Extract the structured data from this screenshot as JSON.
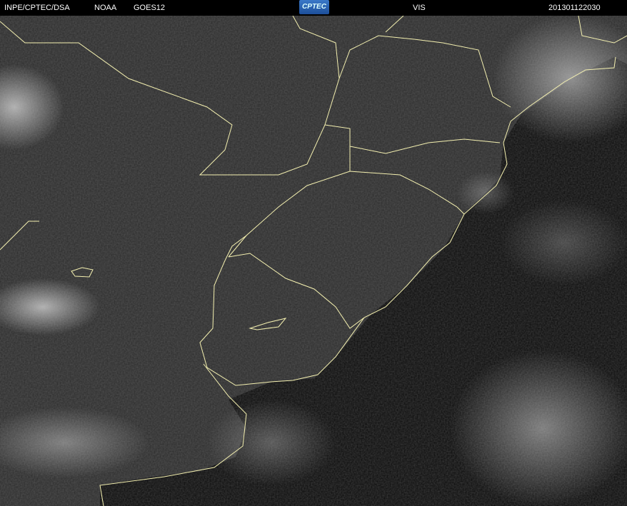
{
  "header": {
    "source": "INPE/CPTEC/DSA",
    "agency": "NOAA",
    "satellite": "GOES12",
    "logo": "CPTEC",
    "channel": "VIS",
    "timestamp": "201301122030"
  },
  "colors": {
    "border_line": "#f4f0b0",
    "land": "#2a2a2a",
    "ocean": "#080808",
    "cloud": "#d8d8d8"
  }
}
